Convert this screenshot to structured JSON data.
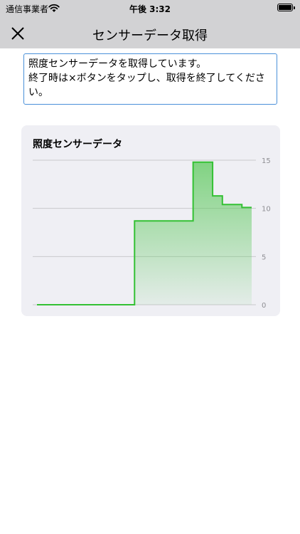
{
  "status_bar": {
    "carrier": "通信事業者",
    "time": "午後 3:32"
  },
  "nav": {
    "title": "センサーデータ取得",
    "close_icon": "close-icon"
  },
  "notice": {
    "text": "照度センサーデータを取得しています。\n終了時は×ボタンをタップし、取得を終了してください。"
  },
  "chart_data": {
    "type": "line",
    "title": "照度センサーデータ",
    "step": true,
    "fill": true,
    "color": "#34c134",
    "y_ticks": [
      "0",
      "5",
      "10",
      "15"
    ],
    "ylim": [
      0,
      15
    ],
    "x": [
      0,
      1,
      2,
      3,
      4,
      5,
      6,
      7,
      8,
      9,
      10,
      11,
      12,
      13,
      14,
      15,
      16,
      17,
      18,
      19,
      20,
      21,
      22
    ],
    "values": [
      0,
      0,
      0,
      0,
      0,
      0,
      0,
      0,
      0,
      0,
      8.7,
      8.7,
      8.7,
      8.7,
      8.7,
      8.7,
      14.8,
      14.8,
      11.3,
      10.4,
      10.4,
      10.1,
      10.1
    ],
    "grid": true,
    "y_axis_side": "right"
  }
}
